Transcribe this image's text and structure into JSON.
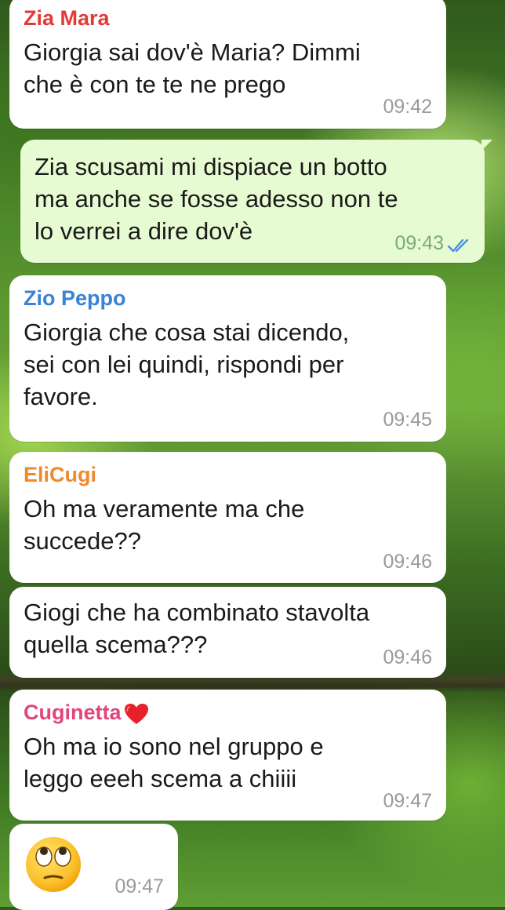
{
  "messages": [
    {
      "sender": "Zia Mara",
      "sender_color": "#e53935",
      "lines": [
        "Giorgia sai dov'è Maria? Dimmi",
        "che è con te te ne prego"
      ],
      "time": "09:42"
    },
    {
      "sender": "",
      "outgoing": true,
      "lines": [
        "Zia scusami mi dispiace un botto",
        "ma anche se fosse adesso non te",
        "lo verrei a dire dov'è"
      ],
      "time": "09:43",
      "status": "read"
    },
    {
      "sender": "Zio Peppo",
      "sender_color": "#3b82d6",
      "lines": [
        "Giorgia che cosa stai dicendo,",
        "sei con lei quindi, rispondi per",
        "favore."
      ],
      "time": "09:45"
    },
    {
      "sender": "EliCugi",
      "sender_color": "#ef8a2c",
      "lines": [
        "Oh ma veramente ma che",
        "succede??"
      ],
      "time": "09:46"
    },
    {
      "sender": "",
      "lines": [
        "Giogi che ha combinato stavolta",
        "quella scema???"
      ],
      "time": "09:46"
    },
    {
      "sender": "Cuginetta",
      "sender_color": "#e0457b",
      "sender_emoji": "red-heart",
      "lines": [
        "Oh ma io sono nel gruppo e",
        "leggo eeeh scema a chiiii"
      ],
      "time": "09:47"
    },
    {
      "sender": "",
      "emoji": "face-with-rolling-eyes",
      "time": "09:47"
    }
  ]
}
